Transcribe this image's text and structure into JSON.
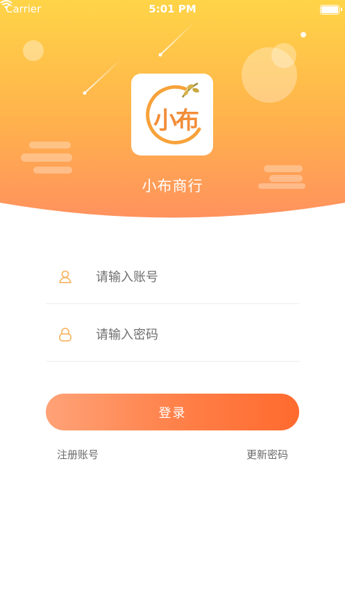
{
  "status_bar": {
    "carrier": "Carrier",
    "time": "5:01 PM"
  },
  "app": {
    "logo_text": "小布",
    "name": "小布商行"
  },
  "form": {
    "account_placeholder": "请输入账号",
    "password_placeholder": "请输入密码",
    "login_label": "登录"
  },
  "links": {
    "register": "注册账号",
    "reset_password": "更新密码"
  },
  "colors": {
    "header_top": "#ffd24a",
    "header_bottom": "#ff9a5c",
    "accent": "#ff7f47",
    "icon": "#f7b86a"
  },
  "icons": {
    "account": "user-icon",
    "password": "lock-icon"
  }
}
